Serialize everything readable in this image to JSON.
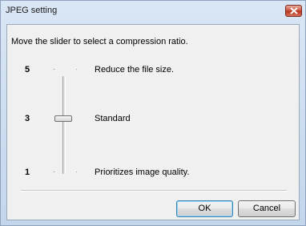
{
  "window": {
    "title": "JPEG setting",
    "close_icon": "close-icon"
  },
  "dialog": {
    "instruction": "Move the slider to select a compression ratio.",
    "slider": {
      "min": 1,
      "max": 5,
      "value": 3,
      "ticks": [
        {
          "number": "5",
          "description": "Reduce the file size."
        },
        {
          "number": "3",
          "description": "Standard"
        },
        {
          "number": "1",
          "description": "Prioritizes image quality."
        }
      ]
    }
  },
  "buttons": {
    "ok": "OK",
    "cancel": "Cancel"
  }
}
